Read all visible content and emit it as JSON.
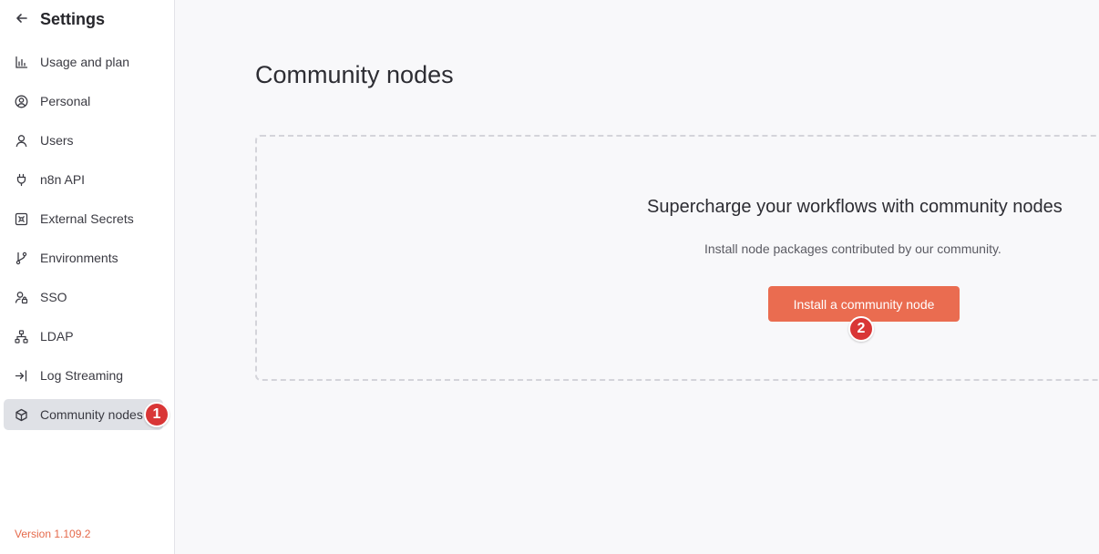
{
  "sidebar": {
    "title": "Settings",
    "back_icon": "arrow-left-icon",
    "items": [
      {
        "label": "Usage and plan",
        "icon": "chart-bar-icon"
      },
      {
        "label": "Personal",
        "icon": "user-circle-icon"
      },
      {
        "label": "Users",
        "icon": "user-icon"
      },
      {
        "label": "n8n API",
        "icon": "plug-icon"
      },
      {
        "label": "External Secrets",
        "icon": "vault-icon"
      },
      {
        "label": "Environments",
        "icon": "git-branch-icon"
      },
      {
        "label": "SSO",
        "icon": "user-lock-icon"
      },
      {
        "label": "LDAP",
        "icon": "network-icon"
      },
      {
        "label": "Log Streaming",
        "icon": "sign-in-icon"
      },
      {
        "label": "Community nodes",
        "icon": "cube-icon",
        "active": true
      }
    ],
    "version": "Version 1.109.2"
  },
  "main": {
    "title": "Community nodes",
    "empty_state": {
      "heading": "Supercharge your workflows with community nodes",
      "description": "Install node packages contributed by our community.",
      "button_label": "Install a community node"
    }
  },
  "badges": [
    "1",
    "2"
  ],
  "colors": {
    "accent": "#ea6c50",
    "badge": "#d93636",
    "active_item_bg": "#dfe1e6"
  }
}
